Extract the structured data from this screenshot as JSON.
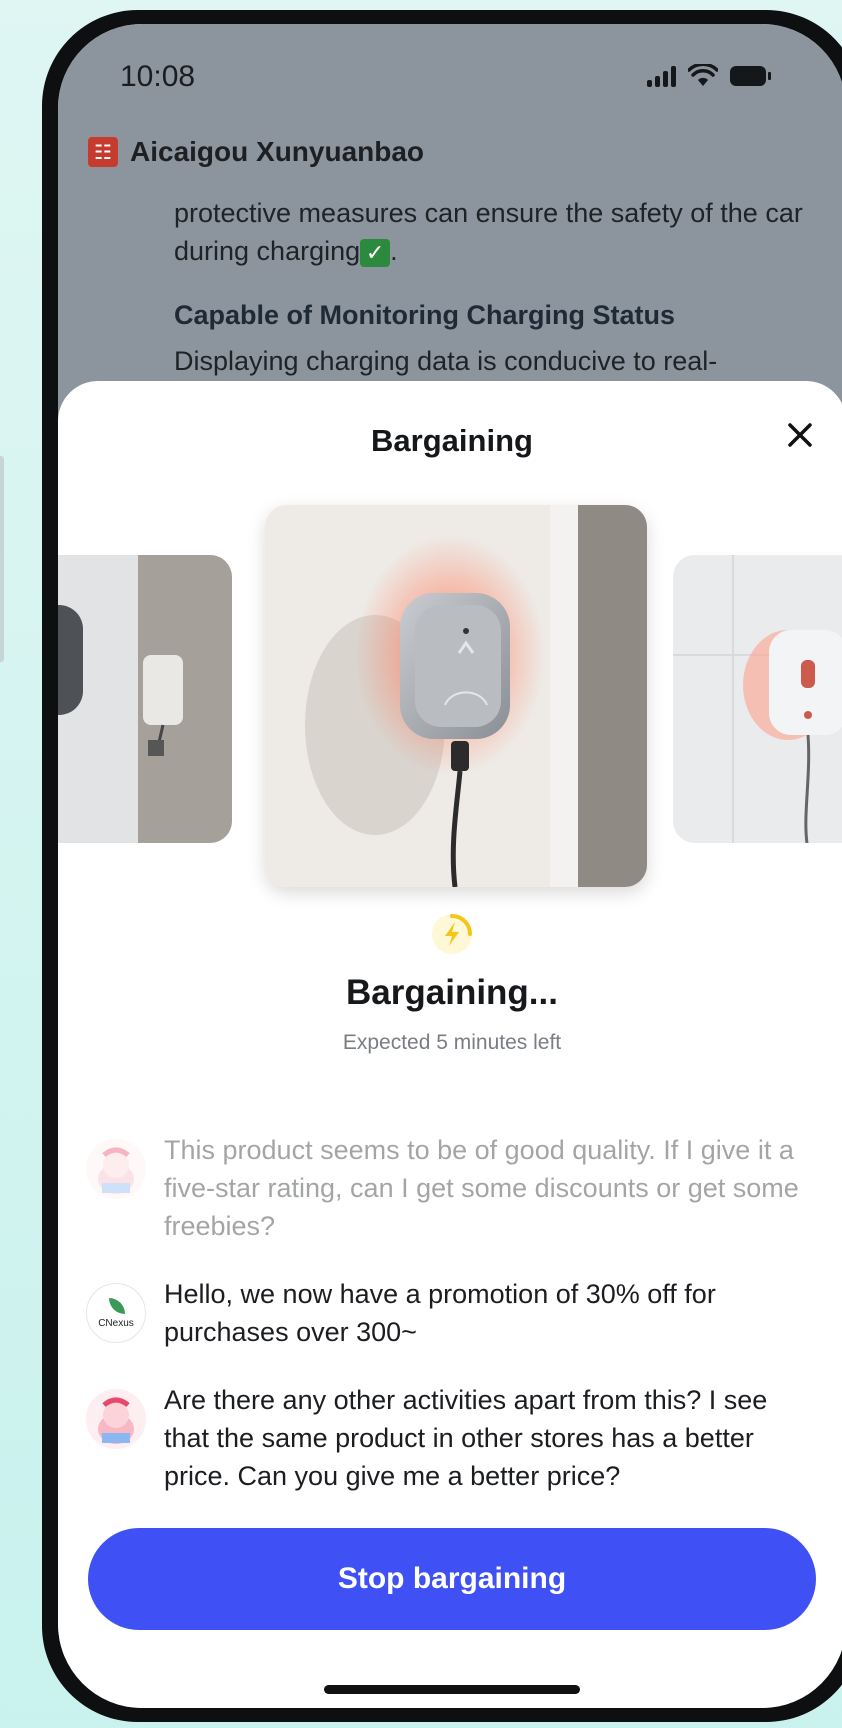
{
  "status_bar": {
    "time": "10:08"
  },
  "background_page": {
    "shop_name": "Aicaigou Xunyuanbao",
    "paragraph": "protective measures can ensure the safety of the car during charging",
    "paragraph_end": ".",
    "heading": "Capable of Monitoring Charging Status",
    "paragraph2": "Displaying charging data is conducive to real-"
  },
  "sheet": {
    "title": "Bargaining",
    "status_title": "Bargaining...",
    "status_subtitle": "Expected 5 minutes left",
    "messages": [
      {
        "sender": "user",
        "text": "This product seems to be of good quality. If I give it a five-star rating, can I get some discounts or get some freebies?"
      },
      {
        "sender": "shop",
        "avatar_label": "CNexus",
        "text": "Hello, we now have a promotion of 30% off for purchases over 300~"
      },
      {
        "sender": "user",
        "text": "Are there any other activities apart from this? I see that the same product in other stores has a better price. Can you give me a better price?"
      }
    ],
    "stop_button_label": "Stop bargaining"
  },
  "colors": {
    "accent": "#3f51f5",
    "bolt": "#f5c518",
    "overlay": "#8c949d"
  }
}
